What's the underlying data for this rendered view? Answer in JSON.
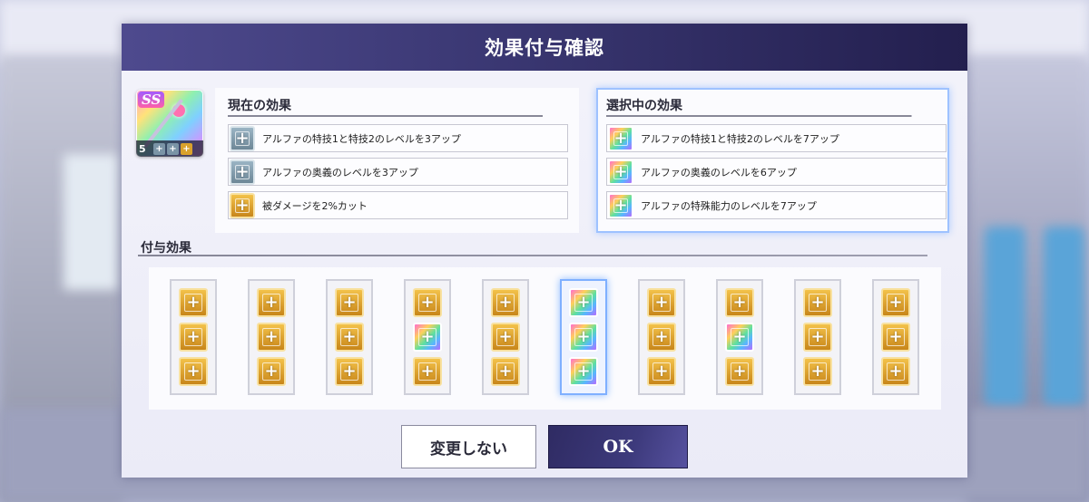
{
  "dialog": {
    "title": "効果付与確認"
  },
  "equipment": {
    "rank": "SS",
    "level": "5",
    "slot_icons": [
      "plus-silver",
      "plus-silver",
      "plus-gold"
    ]
  },
  "current_effects": {
    "title": "現在の効果",
    "items": [
      {
        "icon": "silver",
        "text": "アルファの特技1と特技2のレベルを3アップ"
      },
      {
        "icon": "silver",
        "text": "アルファの奥義のレベルを3アップ"
      },
      {
        "icon": "gold",
        "text": "被ダメージを2%カット"
      }
    ]
  },
  "selected_effects": {
    "title": "選択中の効果",
    "items": [
      {
        "icon": "rainbow",
        "text": "アルファの特技1と特技2のレベルを7アップ"
      },
      {
        "icon": "rainbow",
        "text": "アルファの奥義のレベルを6アップ"
      },
      {
        "icon": "rainbow",
        "text": "アルファの特殊能力のレベルを7アップ"
      }
    ]
  },
  "fuyo": {
    "title": "付与効果",
    "selected_index": 5,
    "slots": [
      [
        "gold",
        "gold",
        "gold"
      ],
      [
        "gold",
        "gold",
        "gold"
      ],
      [
        "gold",
        "gold",
        "gold"
      ],
      [
        "gold",
        "rainbow",
        "gold"
      ],
      [
        "gold",
        "gold",
        "gold"
      ],
      [
        "rainbow",
        "rainbow",
        "rainbow"
      ],
      [
        "gold",
        "gold",
        "gold"
      ],
      [
        "gold",
        "rainbow",
        "gold"
      ],
      [
        "gold",
        "gold",
        "gold"
      ],
      [
        "gold",
        "gold",
        "gold"
      ]
    ]
  },
  "buttons": {
    "cancel": "変更しない",
    "ok": "OK"
  },
  "colors": {
    "title_bar": "#3a3772",
    "gold": "#d9a22c",
    "silver": "#7a94a6",
    "highlight": "#9ec2ff"
  }
}
